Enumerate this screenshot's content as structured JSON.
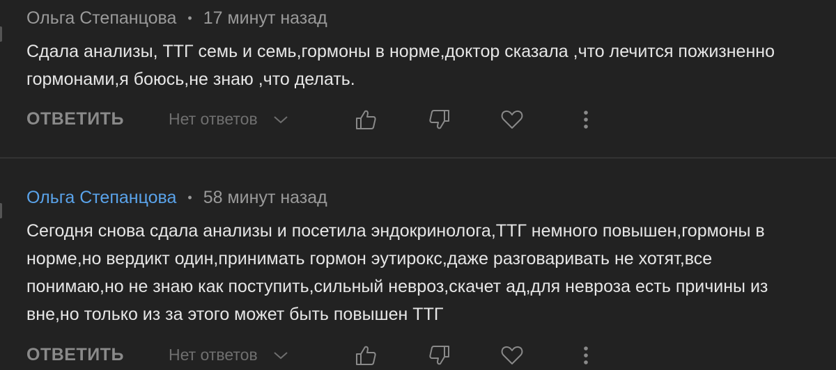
{
  "comments": [
    {
      "author": "Ольга Степанцова",
      "time": "17 минут назад",
      "text": "Сдала анализы, ТТГ семь и семь,гормоны в норме,доктор сказала ,что лечится пожизненно гормонами,я боюсь,не знаю ,что делать.",
      "reply_label": "ОТВЕТИТЬ",
      "replies_label": "Нет ответов"
    },
    {
      "author": "Ольга Степанцова",
      "time": "58 минут назад",
      "text": "Сегодня снова сдала анализы и посетила эндокринолога,ТТГ немного повышен,гормоны в норме,но вердикт один,принимать гормон эутирокс,даже разговаривать не хотят,все понимаю,но не знаю как поступить,сильный невроз,скачет ад,для невроза есть причины из вне,но только из за этого может быть повышен ТТГ",
      "reply_label": "ОТВЕТИТЬ",
      "replies_label": "Нет ответов"
    }
  ],
  "colors": {
    "background": "#222222",
    "text": "#e6e6e6",
    "muted": "#9a9a9a",
    "author_highlight": "#5aa3ea"
  },
  "icons": [
    "chevron-down-icon",
    "thumbs-up-icon",
    "thumbs-down-icon",
    "heart-icon",
    "more-vert-icon"
  ]
}
